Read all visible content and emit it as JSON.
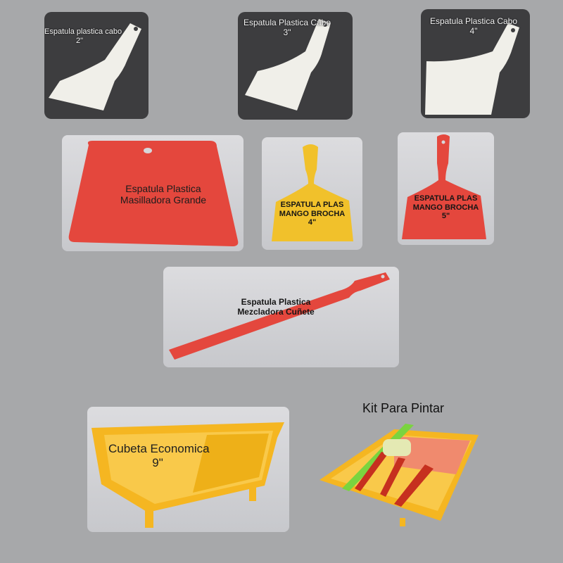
{
  "products": [
    {
      "lines": [
        "Espatula plastica cabo",
        "2\""
      ],
      "color": "#f0efe9"
    },
    {
      "lines": [
        "Espatula Plastica Cabo",
        "3\""
      ],
      "color": "#f0efe9"
    },
    {
      "lines": [
        "Espatula Plastica Cabo",
        "4\""
      ],
      "color": "#f0efe9"
    },
    {
      "lines": [
        "Espatula Plastica",
        "Masilladora Grande"
      ],
      "color": "#e4473d"
    },
    {
      "lines": [
        "ESPATULA PLAS",
        "MANGO BROCHA",
        "4\""
      ],
      "color": "#f1c12b"
    },
    {
      "lines": [
        "ESPATULA PLAS",
        "MANGO BROCHA",
        "5\""
      ],
      "color": "#e4473d"
    },
    {
      "lines": [
        "Espatula Plastica",
        "Mezcladora  Cuñete"
      ],
      "color": "#e4473d"
    },
    {
      "lines": [
        "Cubeta Economica",
        "9\""
      ],
      "color": "#f5b621"
    },
    {
      "lines": [
        "Kit Para Pintar"
      ],
      "color": "#f5b621"
    }
  ]
}
